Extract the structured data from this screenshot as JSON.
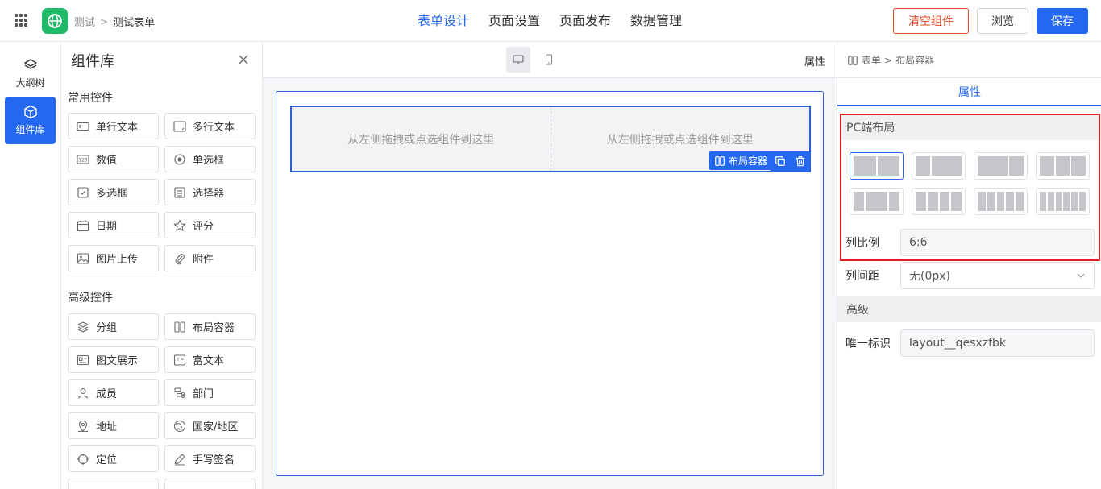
{
  "header": {
    "breadcrumb": [
      "测试",
      "测试表单"
    ],
    "tabs": [
      "表单设计",
      "页面设置",
      "页面发布",
      "数据管理"
    ],
    "active_tab": 0,
    "buttons": {
      "clear": "清空组件",
      "preview": "浏览",
      "save": "保存"
    },
    "accent_color": "#2468f2",
    "danger_color": "#e24e2b"
  },
  "nav": {
    "items": [
      {
        "label": "大纲树",
        "icon": "layers-icon"
      },
      {
        "label": "组件库",
        "icon": "cube-icon",
        "active": true
      }
    ]
  },
  "library": {
    "title": "组件库",
    "groups": [
      {
        "title": "常用控件",
        "items": [
          {
            "label": "单行文本",
            "icon": "single-line-text-icon"
          },
          {
            "label": "多行文本",
            "icon": "multi-line-text-icon"
          },
          {
            "label": "数值",
            "icon": "number-icon"
          },
          {
            "label": "单选框",
            "icon": "radio-icon"
          },
          {
            "label": "多选框",
            "icon": "checkbox-icon"
          },
          {
            "label": "选择器",
            "icon": "select-icon"
          },
          {
            "label": "日期",
            "icon": "calendar-icon"
          },
          {
            "label": "评分",
            "icon": "star-icon"
          },
          {
            "label": "图片上传",
            "icon": "image-upload-icon"
          },
          {
            "label": "附件",
            "icon": "paperclip-icon"
          }
        ]
      },
      {
        "title": "高级控件",
        "items": [
          {
            "label": "分组",
            "icon": "group-icon"
          },
          {
            "label": "布局容器",
            "icon": "columns-icon"
          },
          {
            "label": "图文展示",
            "icon": "image-text-icon"
          },
          {
            "label": "富文本",
            "icon": "rich-text-icon"
          },
          {
            "label": "成员",
            "icon": "user-icon"
          },
          {
            "label": "部门",
            "icon": "org-tree-icon"
          },
          {
            "label": "地址",
            "icon": "location-pin-icon"
          },
          {
            "label": "国家/地区",
            "icon": "globe-icon"
          },
          {
            "label": "定位",
            "icon": "target-icon"
          },
          {
            "label": "手写签名",
            "icon": "pen-icon"
          }
        ]
      }
    ]
  },
  "canvas": {
    "properties_link": "属性",
    "placeholder": "从左侧拖拽或点选组件到这里",
    "layout_tag": "布局容器"
  },
  "panel": {
    "breadcrumb": [
      "表单",
      "布局容器"
    ],
    "tab": "属性",
    "pc_layout_title": "PC端布局",
    "layout_options": [
      [
        1,
        1
      ],
      [
        1,
        2
      ],
      [
        2,
        1
      ],
      [
        1,
        1,
        1
      ],
      [
        1,
        2,
        1
      ],
      [
        1,
        1,
        1,
        1
      ],
      [
        1,
        1,
        1,
        1,
        1
      ],
      [
        1,
        1,
        1,
        1,
        1,
        1
      ]
    ],
    "selected_layout": 0,
    "ratio_label": "列比例",
    "ratio_value": "6:6",
    "gap_label": "列间距",
    "gap_value": "无(0px)",
    "advanced_title": "高级",
    "id_label": "唯一标识",
    "id_value": "layout__qesxzfbk"
  }
}
